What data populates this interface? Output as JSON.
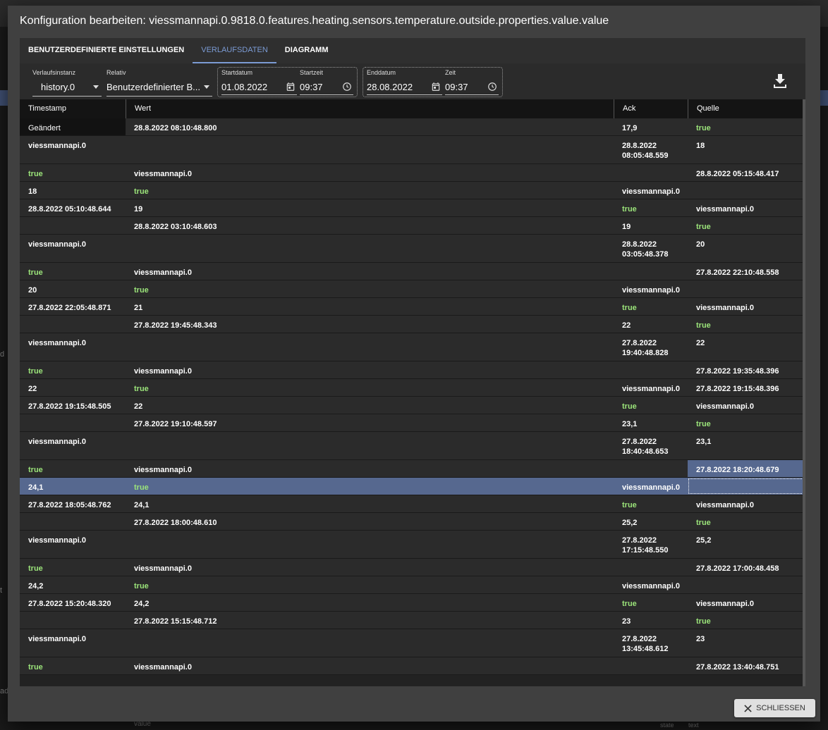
{
  "background": {
    "side_a": "d",
    "side_b": "t",
    "side_c": "ad",
    "footer_left": "value",
    "footer_state": "state",
    "footer_text": "text"
  },
  "dialog": {
    "title": "Konfiguration bearbeiten: viessmannapi.0.9818.0.features.heating.sensors.temperature.outside.properties.value.value",
    "close_label": "SCHLIESSEN"
  },
  "tabs": [
    "BENUTZERDEFINIERTE EINSTELLUNGEN",
    "VERLAUFSDATEN",
    "DIAGRAMM"
  ],
  "toolbar": {
    "instance_label": "Verlaufsinstanz",
    "instance_value": "history.0",
    "relative_label": "Relativ",
    "relative_value": "Benutzerdefinierter B...",
    "start_date_label": "Startdatum",
    "start_date_value": "01.08.2022",
    "start_time_label": "Startzeit",
    "start_time_value": "09:37",
    "end_date_label": "Enddatum",
    "end_date_value": "28.08.2022",
    "end_time_label": "Zeit",
    "end_time_value": "09:37"
  },
  "table": {
    "headers": [
      "Timestamp",
      "Wert",
      "Ack",
      "Quelle"
    ],
    "rows": [
      [
        "Geändert",
        "28.8.2022 08:10:48.800",
        "17,9",
        "true"
      ],
      [
        "viessmannapi.0",
        "",
        "28.8.2022\n08:05:48.559",
        "18"
      ],
      [
        "true",
        "viessmannapi.0",
        "",
        "28.8.2022 05:15:48.417"
      ],
      [
        "18",
        "true",
        "viessmannapi.0",
        ""
      ],
      [
        "28.8.2022 05:10:48.644",
        "19",
        "true",
        "viessmannapi.0"
      ],
      [
        "",
        "28.8.2022 03:10:48.603",
        "19",
        "true"
      ],
      [
        "viessmannapi.0",
        "",
        "28.8.2022\n03:05:48.378",
        "20"
      ],
      [
        "true",
        "viessmannapi.0",
        "",
        "27.8.2022 22:10:48.558"
      ],
      [
        "20",
        "true",
        "viessmannapi.0",
        ""
      ],
      [
        "27.8.2022 22:05:48.871",
        "21",
        "true",
        "viessmannapi.0"
      ],
      [
        "",
        "27.8.2022 19:45:48.343",
        "22",
        "true"
      ],
      [
        "viessmannapi.0",
        "",
        "27.8.2022\n19:40:48.828",
        "22"
      ],
      [
        "true",
        "viessmannapi.0",
        "",
        "27.8.2022 19:35:48.396"
      ],
      [
        "22",
        "true",
        "viessmannapi.0",
        "27.8.2022 19:15:48.396"
      ],
      [
        "27.8.2022 19:15:48.505",
        "22",
        "true",
        "viessmannapi.0"
      ],
      [
        "",
        "27.8.2022 19:10:48.597",
        "23,1",
        "true"
      ],
      [
        "viessmannapi.0",
        "",
        "27.8.2022\n18:40:48.653",
        "23,1"
      ],
      [
        "true",
        "viessmannapi.0",
        "",
        "27.8.2022 18:20:48.679"
      ],
      [
        "24,1",
        "true",
        "viessmannapi.0",
        ""
      ],
      [
        "27.8.2022 18:05:48.762",
        "24,1",
        "true",
        "viessmannapi.0"
      ],
      [
        "",
        "27.8.2022 18:00:48.610",
        "25,2",
        "true"
      ],
      [
        "viessmannapi.0",
        "",
        "27.8.2022\n17:15:48.550",
        "25,2"
      ],
      [
        "true",
        "viessmannapi.0",
        "",
        "27.8.2022 17:00:48.458"
      ],
      [
        "24,2",
        "true",
        "viessmannapi.0",
        ""
      ],
      [
        "27.8.2022 15:20:48.320",
        "24,2",
        "true",
        "viessmannapi.0"
      ],
      [
        "",
        "27.8.2022 15:15:48.712",
        "23",
        "true"
      ],
      [
        "viessmannapi.0",
        "",
        "27.8.2022\n13:45:48.612",
        "23"
      ],
      [
        "true",
        "viessmannapi.0",
        "",
        "27.8.2022 13:40:48.751"
      ]
    ]
  },
  "colors": {
    "accent": "#7b9bd4",
    "selection": "#56688f",
    "true_value": "#9be47a"
  }
}
